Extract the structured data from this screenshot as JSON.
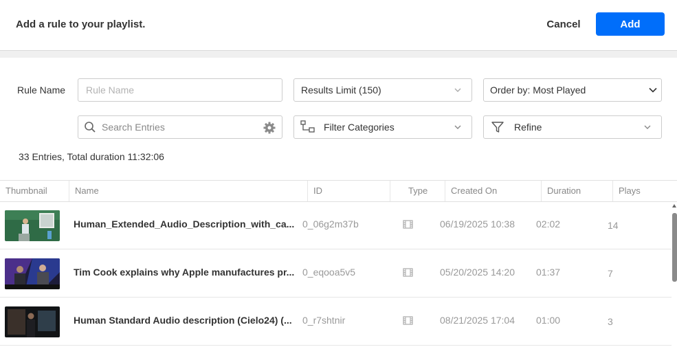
{
  "header": {
    "title": "Add a rule to your playlist.",
    "cancel_label": "Cancel",
    "add_label": "Add",
    "accent_color": "#006efa"
  },
  "form": {
    "rule_name_label": "Rule Name",
    "rule_name_placeholder": "Rule Name",
    "results_limit": "Results Limit (150)",
    "order_by": "Order by: Most Played",
    "search_placeholder": "Search Entries",
    "filter_categories": "Filter Categories",
    "refine": "Refine"
  },
  "summary": "33 Entries, Total duration 11:32:06",
  "table": {
    "columns": [
      "Thumbnail",
      "Name",
      "ID",
      "Type",
      "Created On",
      "Duration",
      "Plays"
    ],
    "rows": [
      {
        "name": "Human_Extended_Audio_Description_with_ca...",
        "id": "0_06g2m37b",
        "type_icon": "video-icon",
        "created": "06/19/2025 10:38",
        "duration": "02:02",
        "plays": "14"
      },
      {
        "name": "Tim Cook explains why Apple manufactures pr...",
        "id": "0_eqooa5v5",
        "type_icon": "video-icon",
        "created": "05/20/2025 14:20",
        "duration": "01:37",
        "plays": "7"
      },
      {
        "name": "Human Standard Audio description (Cielo24) (...",
        "id": "0_r7shtnir",
        "type_icon": "video-icon",
        "created": "08/21/2025 17:04",
        "duration": "01:00",
        "plays": "3"
      }
    ]
  }
}
